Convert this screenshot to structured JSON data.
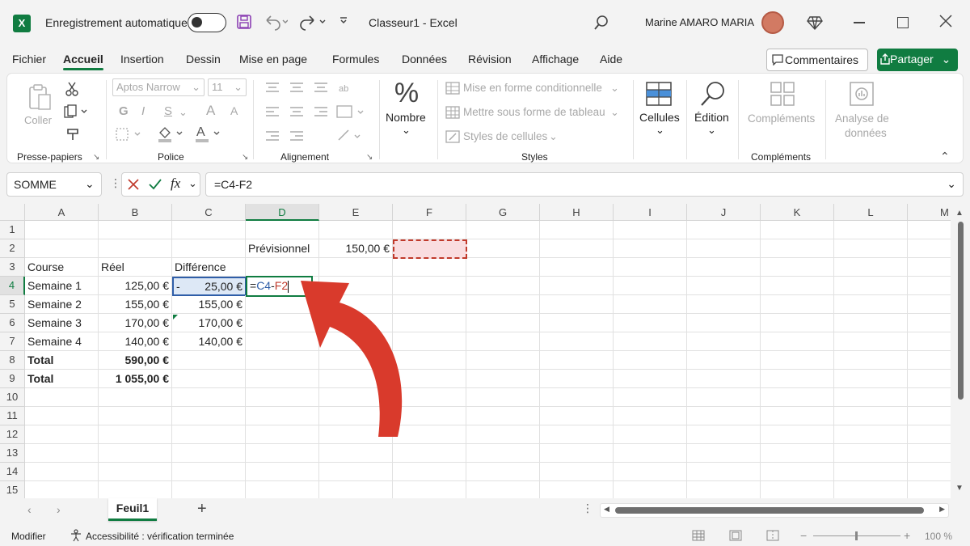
{
  "app": {
    "logo": "X",
    "title": "Classeur1  -  Excel",
    "autosave_label": "Enregistrement automatique",
    "user": "Marine AMARO MARIA"
  },
  "icons": {
    "save": "save-icon",
    "undo": "undo-icon",
    "redo": "redo-icon",
    "search": "search-icon",
    "diamond": "diamond-icon"
  },
  "menu": [
    "Fichier",
    "Accueil",
    "Insertion",
    "Dessin",
    "Mise en page",
    "Formules",
    "Données",
    "Révision",
    "Affichage",
    "Aide"
  ],
  "buttons": {
    "comments": "Commentaires",
    "share": "Partager"
  },
  "ribbon": {
    "clipboard": {
      "paste": "Coller",
      "group": "Presse-papiers"
    },
    "font": {
      "family": "Aptos Narrow",
      "size": "11",
      "bold": "G",
      "italic": "I",
      "underline": "S",
      "grow": "A",
      "shrink": "A",
      "group": "Police"
    },
    "alignment": {
      "group": "Alignement"
    },
    "number": {
      "label": "Nombre"
    },
    "styles": {
      "conditional": "Mise en forme conditionnelle",
      "table": "Mettre sous forme de tableau",
      "cell_styles": "Styles de cellules",
      "group": "Styles"
    },
    "cells": {
      "label": "Cellules"
    },
    "editing": {
      "label": "Édition"
    },
    "addins": {
      "label": "Compléments",
      "group": "Compléments"
    },
    "analyze": {
      "label1": "Analyse de",
      "label2": "données"
    }
  },
  "formula_bar": {
    "name_box": "SOMME",
    "formula": "=C4-F2"
  },
  "columns": [
    "A",
    "B",
    "C",
    "D",
    "E",
    "F",
    "G",
    "H",
    "I",
    "J",
    "K",
    "L",
    "M"
  ],
  "rows": [
    "1",
    "2",
    "3",
    "4",
    "5",
    "6",
    "7",
    "8",
    "9",
    "10",
    "11",
    "12",
    "13",
    "14",
    "15"
  ],
  "cells": {
    "D2": "Prévisionnel",
    "E2": "150,00 €",
    "A3": "Course",
    "B3": "Réel",
    "C3": "Différence",
    "A4": "Semaine 1",
    "B4": "125,00 €",
    "C4a": "-",
    "C4b": "25,00 €",
    "D4a": "=",
    "D4b": "C4",
    "D4c": "-",
    "D4d": "F2",
    "A5": "Semaine 2",
    "B5": "155,00 €",
    "C5": "155,00 €",
    "A6": "Semaine 3",
    "B6": "170,00 €",
    "C6": "170,00 €",
    "A7": "Semaine 4",
    "B7": "140,00 €",
    "C7": "140,00 €",
    "A8": "Total",
    "B8": "590,00 €",
    "A9": "Total",
    "B9": "1 055,00 €"
  },
  "sheet_tab": "Feuil1",
  "add_sheet": "+",
  "status": {
    "mode": "Modifier",
    "accessibility": "Accessibilité : vérification terminée",
    "zoom": "100 %"
  },
  "colors": {
    "excel_green": "#107c41",
    "ref_blue": "#2f5ea8",
    "ref_red": "#c0392b",
    "arrow": "#d93a2c"
  }
}
